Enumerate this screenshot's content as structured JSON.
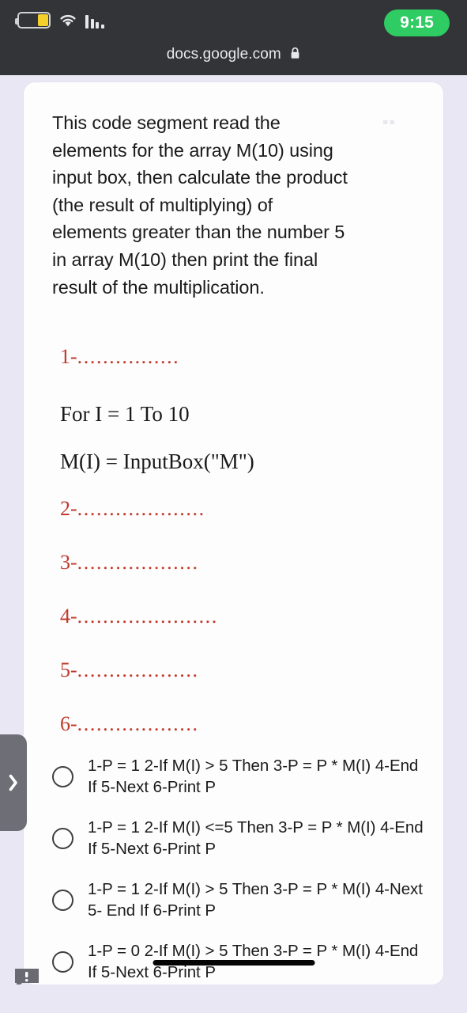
{
  "statusbar": {
    "battery_icon": "battery-low-icon",
    "wifi_icon": "wifi-icon",
    "signal_icon": "cellular-signal-icon",
    "time": "9:15"
  },
  "browser": {
    "url": "docs.google.com",
    "lock_icon": "lock-icon"
  },
  "question": {
    "text": "This code segment read the\nelements for the array M(10) using\ninput box, then calculate the product\n(the result of multiplying)  of\nelements greater than the number  5\n in  array M(10) then print the final\nresult of the multiplication."
  },
  "code": {
    "blank_1": {
      "num": "1-",
      "dots": "................"
    },
    "line_for": "For I = 1 To 10",
    "line_input": "M(I) = InputBox(\"M\")",
    "blank_2": {
      "num": "2-",
      "dots": "...................."
    },
    "blank_3": {
      "num": "3-",
      "dots": "..................."
    },
    "blank_4": {
      "num": "4-",
      "dots": "......................"
    },
    "blank_5": {
      "num": "5-",
      "dots": "..................."
    },
    "blank_6": {
      "num": "6-",
      "dots": "..................."
    }
  },
  "options": [
    {
      "id": "option-a",
      "label": "1-P = 1 2-If M(I) > 5 Then 3-P = P * M(I) 4-End If 5-Next 6-Print P",
      "selected": false
    },
    {
      "id": "option-b",
      "label": "1-P = 1 2-If M(I) <=5 Then 3-P = P * M(I) 4-End If 5-Next 6-Print P",
      "selected": false
    },
    {
      "id": "option-c",
      "label": "1-P = 1 2-If M(I) > 5 Then 3-P = P * M(I) 4-Next 5- End If 6-Print P",
      "selected": false
    },
    {
      "id": "option-d",
      "label": "1-P = 0 2-If M(I) > 5 Then 3-P = P * M(I) 4-End If 5-Next 6-Print P",
      "selected": false
    }
  ],
  "side_tab": {
    "icon": "chevron-right-icon"
  },
  "feedback": {
    "icon": "feedback-bubble-icon"
  },
  "colors": {
    "chrome_bg": "#323437",
    "page_bg": "#e9e7f3",
    "card_bg": "#fdfdfd",
    "accent_red": "#c0392b",
    "time_pill_green": "#2ecc63",
    "battery_yellow": "#f5cf2a",
    "side_tab_gray": "#6e6e76"
  }
}
